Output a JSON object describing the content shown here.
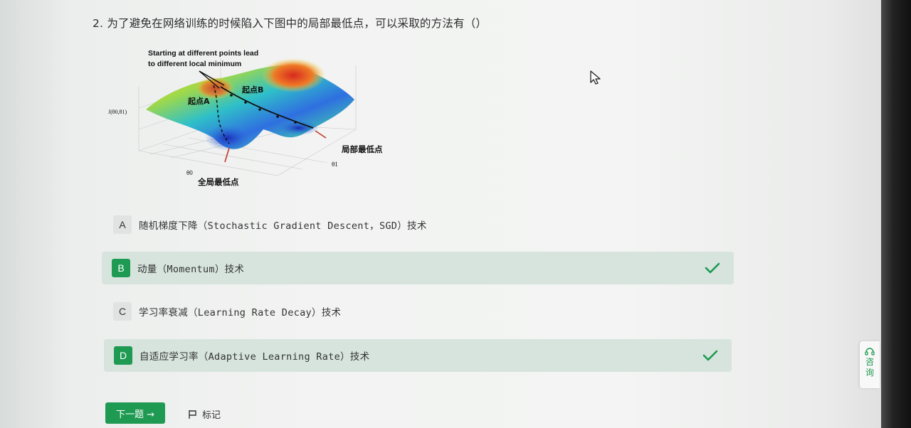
{
  "question": {
    "text": "2. 为了避免在网络训练的时候陷入下图中的局部最低点，可以采取的方法有（）"
  },
  "figure": {
    "caption_line1": "Starting at different points lead",
    "caption_line2": "to different local minimum",
    "label_start_a": "起点A",
    "label_start_b": "起点B",
    "label_local_min": "局部最低点",
    "label_global_min": "全局最低点",
    "label_axis_j": "J(θ0,θ1)",
    "label_axis_theta0": "θ0",
    "label_axis_theta1": "θ1"
  },
  "options": [
    {
      "letter": "A",
      "text": "随机梯度下降（Stochastic Gradient Descent，SGD）技术",
      "selected": false
    },
    {
      "letter": "B",
      "text": "动量（Momentum）技术",
      "selected": true
    },
    {
      "letter": "C",
      "text": "学习率衰减（Learning Rate Decay）技术",
      "selected": false
    },
    {
      "letter": "D",
      "text": "自适应学习率（Adaptive Learning Rate）技术",
      "selected": true
    }
  ],
  "footer": {
    "next_label": "下一题 →",
    "mark_label": "标记"
  },
  "side": {
    "consult_label": "咨询",
    "consult_icon": "headset-icon"
  },
  "colors": {
    "accent": "#1f9a52",
    "selected_bg": "#d6e4dd"
  }
}
